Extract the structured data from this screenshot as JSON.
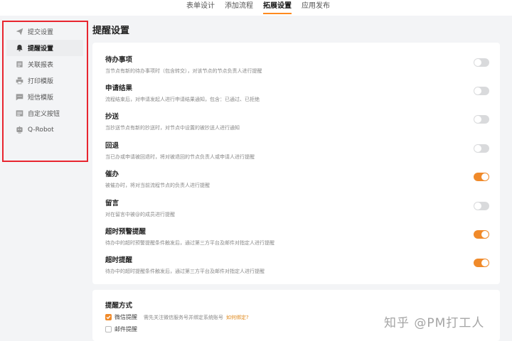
{
  "tabs": [
    "表单设计",
    "添加流程",
    "拓展设置",
    "应用发布"
  ],
  "sidebar": {
    "items": [
      {
        "label": "提交设置",
        "icon": "send-icon"
      },
      {
        "label": "提醒设置",
        "icon": "bell-icon"
      },
      {
        "label": "关联报表",
        "icon": "report-icon"
      },
      {
        "label": "打印模版",
        "icon": "printer-icon"
      },
      {
        "label": "短信模版",
        "icon": "message-icon"
      },
      {
        "label": "自定义按钮",
        "icon": "list-icon"
      },
      {
        "label": "Q-Robot",
        "icon": "robot-icon"
      }
    ],
    "active": "提醒设置"
  },
  "page_title": "提醒设置",
  "rows": [
    {
      "title": "待办事项",
      "desc": "当节点有新的待办事项时（包含转交），对该节点的节点负责人进行提醒",
      "on": false
    },
    {
      "title": "申请结果",
      "desc": "流程结束后，对申请发起人进行申请结果通知，包含：已通过、已拒绝",
      "on": false
    },
    {
      "title": "抄送",
      "desc": "当抄送节点有新的抄送时，对节点中设置的被抄送人进行通知",
      "on": false
    },
    {
      "title": "回退",
      "desc": "当已办或申请被回退时，将对被退回的节点负责人或申请人进行提醒",
      "on": false
    },
    {
      "title": "催办",
      "desc": "被催办时，将对当前流程节点的负责人进行提醒",
      "on": true
    },
    {
      "title": "留言",
      "desc": "对在留言中被@的成员进行提醒",
      "on": false
    },
    {
      "title": "超时预警提醒",
      "desc": "待办中的超时预警提醒条件触发后，通过第三方平台及邮件对指定人进行提醒",
      "on": true
    },
    {
      "title": "超时提醒",
      "desc": "待办中的超时提醒条件触发后，通过第三方平台及邮件对指定人进行提醒",
      "on": true
    }
  ],
  "method": {
    "title": "提醒方式",
    "wechat_label": "微信提醒",
    "wechat_checked": true,
    "wechat_note": "需先关注微信服务号并绑定系统账号",
    "wechat_link": "如何绑定?",
    "email_label": "邮件提醒",
    "email_checked": false
  },
  "watermark": "知乎 @PM打工人",
  "colors": {
    "accent": "#f08a2a",
    "highlight_border": "#e8252f"
  }
}
